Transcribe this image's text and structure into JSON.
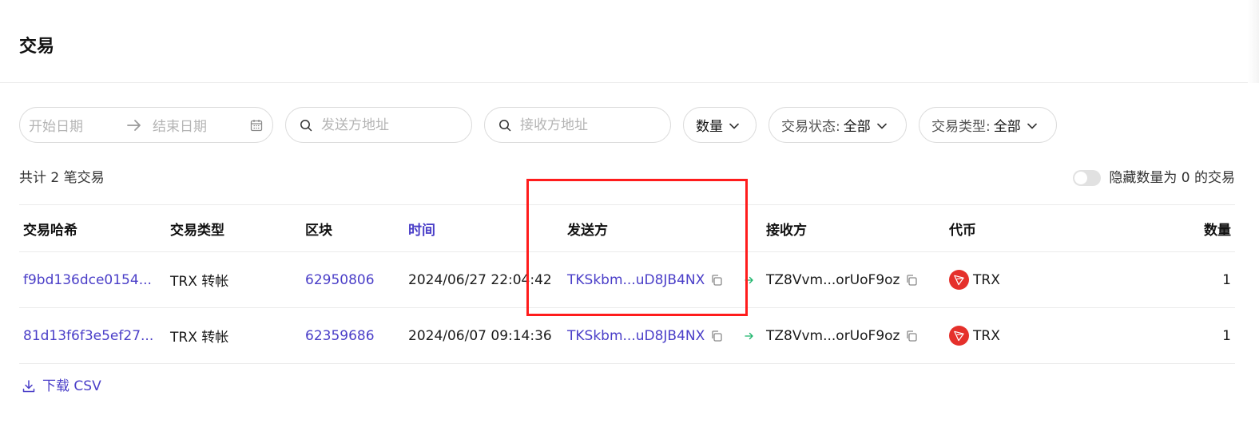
{
  "page": {
    "title": "交易"
  },
  "filters": {
    "start_date_placeholder": "开始日期",
    "end_date_placeholder": "结束日期",
    "sender_placeholder": "发送方地址",
    "receiver_placeholder": "接收方地址",
    "amount_label": "数量",
    "status_label": "交易状态:",
    "status_value": "全部",
    "type_label": "交易类型:",
    "type_value": "全部"
  },
  "summary": {
    "text": "共计 2 笔交易"
  },
  "hide_zero": {
    "label": "隐藏数量为 0 的交易",
    "enabled": false
  },
  "table": {
    "columns": [
      "交易哈希",
      "交易类型",
      "区块",
      "时间",
      "发送方",
      "接收方",
      "代币",
      "数量"
    ],
    "rows": [
      {
        "hash": "f9bd136dce0154...",
        "type": "TRX 转帐",
        "block": "62950806",
        "time": "2024/06/27 22:04:42",
        "from": "TKSkbm...uD8JB4NX",
        "to": "TZ8Vvm...orUoF9oz",
        "token": "TRX",
        "amount": "1"
      },
      {
        "hash": "81d13f6f3e5ef27...",
        "type": "TRX 转帐",
        "block": "62359686",
        "time": "2024/06/07 09:14:36",
        "from": "TKSkbm...uD8JB4NX",
        "to": "TZ8Vvm...orUoF9oz",
        "token": "TRX",
        "amount": "1"
      }
    ]
  },
  "download": {
    "label": "下载 CSV"
  },
  "colors": {
    "accent": "#4a3ec8",
    "highlight": "#ff1c1c",
    "trx": "#e5302b",
    "arrow": "#1bb46a"
  }
}
